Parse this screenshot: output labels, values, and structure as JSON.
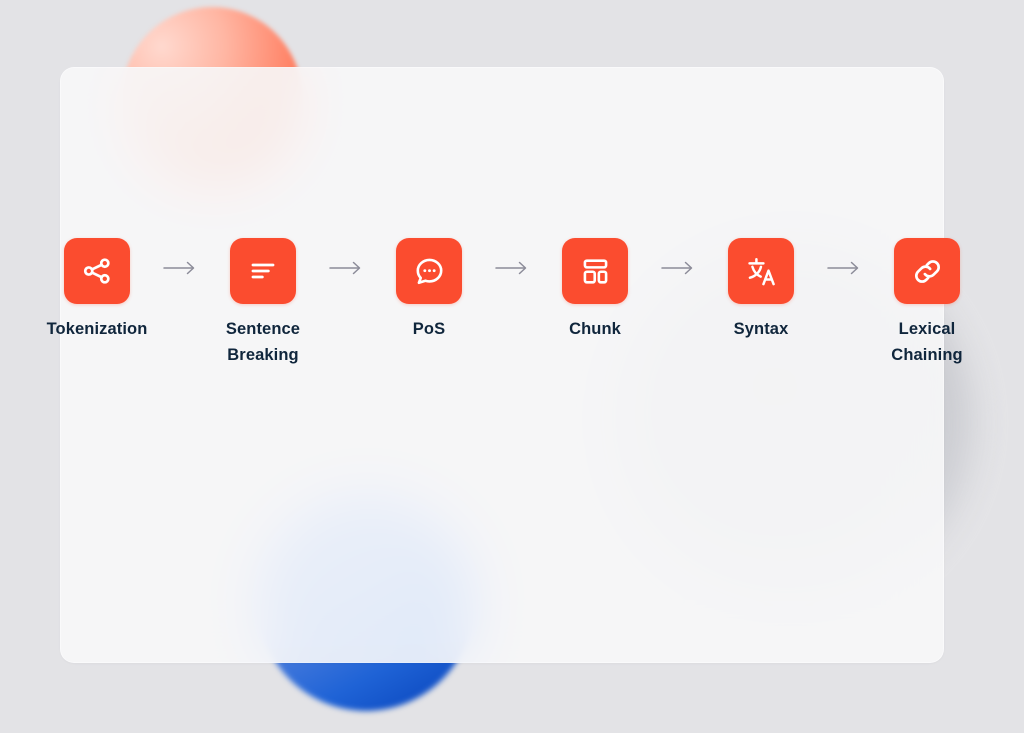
{
  "theme": {
    "page_background": "#e3e3e6",
    "panel_background": "#f7f7f8",
    "accent": "#fb4c2f",
    "label_color": "#10263c",
    "arrow_color": "#8c8c99",
    "blob_red": "#ff522f",
    "blob_blue": "#0540b8",
    "blob_grey": "#c6c7cc"
  },
  "decorations": [
    {
      "name": "red-circle",
      "color": "#ff7a5c"
    },
    {
      "name": "blue-circle",
      "color": "#1f63d6"
    },
    {
      "name": "grey-circle",
      "color": "#c6c7cc"
    }
  ],
  "pipeline": {
    "arrow_glyph": "→",
    "steps": [
      {
        "label": "Tokenization",
        "icon": "share-nodes-icon"
      },
      {
        "label": "Sentence\nBreaking",
        "icon": "text-align-left-icon"
      },
      {
        "label": "PoS",
        "icon": "speech-bubble-dots-icon"
      },
      {
        "label": "Chunk",
        "icon": "layout-blocks-icon"
      },
      {
        "label": "Syntax",
        "icon": "translate-icon"
      },
      {
        "label": "Lexical\nChaining",
        "icon": "chain-link-icon"
      }
    ]
  }
}
